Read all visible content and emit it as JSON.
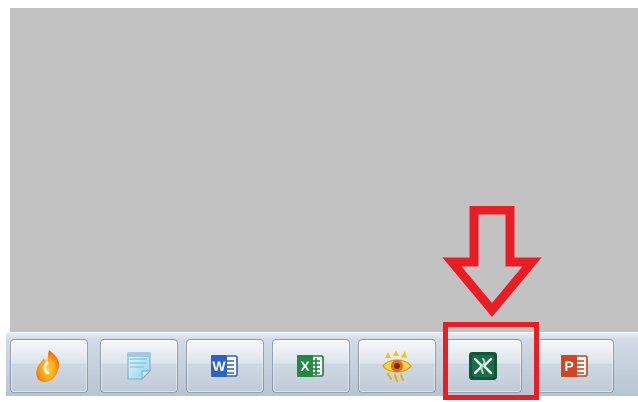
{
  "taskbar": {
    "items": [
      {
        "icon": "blaze-flame-icon"
      },
      {
        "icon": "notepad-icon"
      },
      {
        "icon": "word-icon",
        "label": "W"
      },
      {
        "icon": "excel-icon",
        "label": "X"
      },
      {
        "icon": "eye-gallery-icon"
      },
      {
        "icon": "project-app-icon"
      },
      {
        "icon": "powerpoint-icon",
        "label": "P"
      }
    ]
  },
  "annotation": {
    "highlight_color": "#ea1d24",
    "arrow_direction": "down",
    "target_icon": "project-app-icon"
  }
}
